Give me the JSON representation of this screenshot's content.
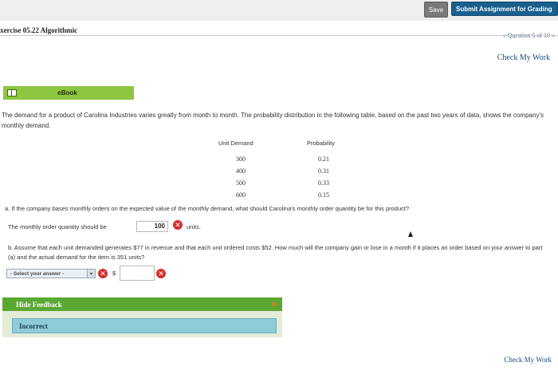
{
  "toolbar": {
    "save_label": "Save",
    "submit_label": "Submit Assignment for Grading"
  },
  "header": {
    "exercise_title": "xercise 05.22 Algorithmic",
    "question_nav": "« Question 5 of 10 »",
    "check_my_work": "Check My Work"
  },
  "ebook": {
    "label": "eBook"
  },
  "problem": {
    "intro": "The demand for a product of Carolina Industries varies greatly from month to month. The probability distribution in the following table, based on the past two years of data, shows the company's monthly demand.",
    "table": {
      "headers": [
        "Unit Demand",
        "Probability"
      ],
      "rows": [
        [
          "300",
          "0.21"
        ],
        [
          "400",
          "0.31"
        ],
        [
          "500",
          "0.33"
        ],
        [
          "600",
          "0.15"
        ]
      ]
    },
    "part_a": {
      "question": "a. If the company bases monthly orders on the expected value of the monthly demand, what should Carolina's monthly order quantity be for this product?",
      "answer_prefix": "The monthly order quantity should be",
      "answer_value": "100",
      "answer_suffix": "units."
    },
    "part_b": {
      "question": "b. Assume that each unit demanded generates $77 in revenue and that each unit ordered costs $52. How much will the company gain or lose in a month if it places an order based on your answer to part (a) and the actual demand for the item is 351 units?",
      "select_value": "- Select your answer -",
      "currency_symbol": "$",
      "amount_value": ""
    }
  },
  "feedback": {
    "toggle_label": "Hide Feedback",
    "status": "Incorrect"
  },
  "footer": {
    "check_my_work": "Check My Work"
  },
  "colors": {
    "ebook_bar": "#8dc63f",
    "feedback_bar": "#5aa832",
    "incorrect_box": "#8fcbd7",
    "submit_button": "#1a5f8e",
    "error_icon": "#d32f2f"
  },
  "icons": {
    "ebook": "book-icon",
    "error": "x-circle-icon",
    "select_arrow": "chevron-down-icon"
  }
}
